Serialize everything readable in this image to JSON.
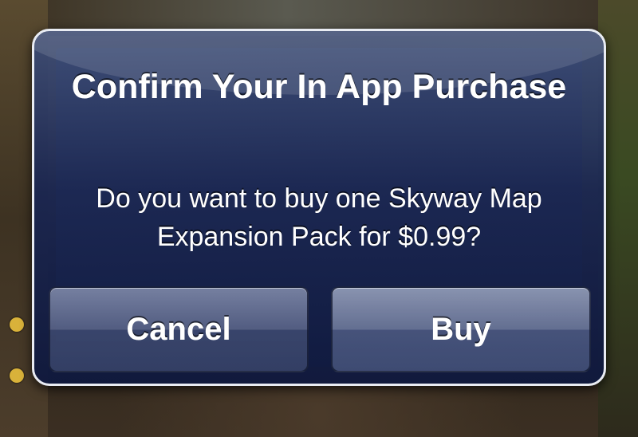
{
  "alert": {
    "title": "Confirm Your In App Purchase",
    "message": "Do you want to buy one Skyway Map Expansion Pack for $0.99?",
    "buttons": {
      "cancel_label": "Cancel",
      "buy_label": "Buy"
    }
  },
  "colors": {
    "alert_border": "#e9ecf3",
    "alert_background": "#1a2652",
    "text": "#ffffff"
  }
}
